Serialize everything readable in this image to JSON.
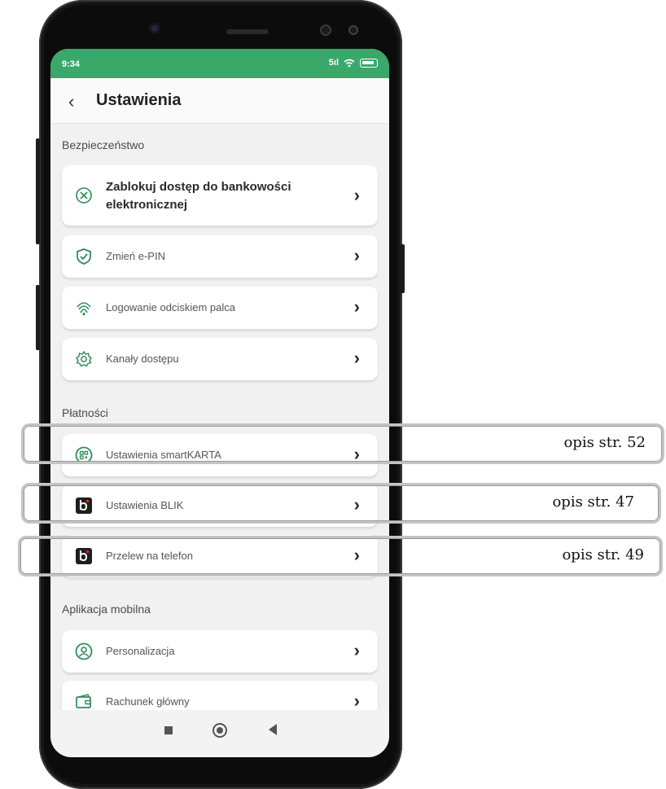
{
  "status": {
    "time": "9:34",
    "signal": "5ıl"
  },
  "header": {
    "back_icon": "chevron-left-icon",
    "title": "Ustawienia"
  },
  "sections": [
    {
      "label": "Bezpieczeństwo",
      "items": [
        {
          "label": "Zablokuj dostęp do bankowości elektronicznej",
          "icon": "block-icon"
        },
        {
          "label": "Zmień e-PIN",
          "icon": "shield-check-icon"
        },
        {
          "label": "Logowanie odciskiem palca",
          "icon": "fingerprint-icon"
        },
        {
          "label": "Kanały dostępu",
          "icon": "gear-icon"
        }
      ]
    },
    {
      "label": "Płatności",
      "items": [
        {
          "label": "Ustawienia smartKARTA",
          "icon": "qr-icon"
        },
        {
          "label": "Ustawienia BLIK",
          "icon": "blik-icon"
        },
        {
          "label": "Przelew na telefon",
          "icon": "blik-icon"
        }
      ]
    },
    {
      "label": "Aplikacja mobilna",
      "items": [
        {
          "label": "Personalizacja",
          "icon": "user-icon"
        },
        {
          "label": "Rachunek główny",
          "icon": "wallet-icon"
        }
      ]
    }
  ],
  "callouts": [
    {
      "text": "opis str. 52"
    },
    {
      "text": "opis str. 47"
    },
    {
      "text": "opis str. 49"
    }
  ],
  "colors": {
    "accent": "#3aa86a",
    "icon_green": "#2e8b57",
    "blik_dark": "#1e1e1e",
    "blik_red": "#e2231a"
  }
}
